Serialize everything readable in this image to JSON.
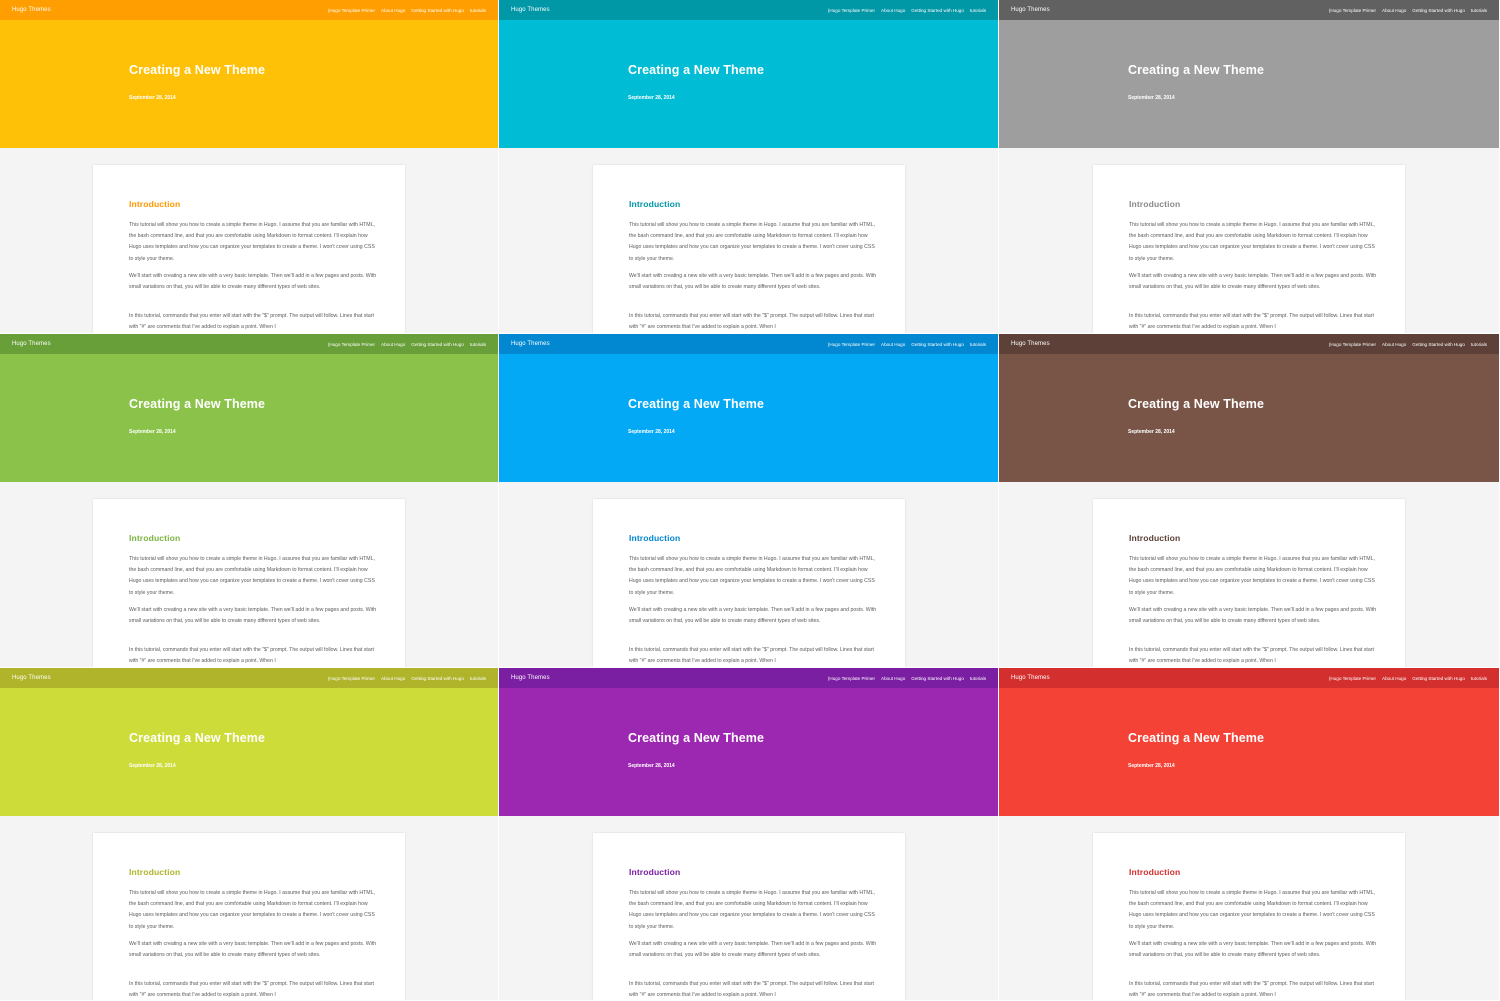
{
  "site": {
    "brand": "Hugo Themes",
    "menu": [
      "(Hugo Template Primer",
      "About Hugo",
      "Getting Started with Hugo",
      "tutorials"
    ]
  },
  "post": {
    "title": "Creating a New Theme",
    "date": "September 28, 2014",
    "heading": "Introduction",
    "paragraphs": [
      "This tutorial will show you how to create a simple theme in Hugo. I assume that you are familiar with HTML, the bash command line, and that you are comfortable using Markdown to format content. I'll explain how Hugo uses templates and how you can organize your templates to create a theme. I won't cover using CSS to style your theme.",
      "We'll start with creating a new site with a very basic template. Then we'll add in a few pages and posts. With small variations on that, you will be able to create many different types of web sites.",
      "In this tutorial, commands that you enter will start with the \"$\" prompt. The output will follow. Lines that start with \"#\" are comments that I've added to explain a point. When I"
    ]
  },
  "variants": [
    {
      "name": "amber",
      "bar": "#ff9e00",
      "hero": "#ffc107",
      "accent": "#ff9800"
    },
    {
      "name": "cyan",
      "bar": "#0097a7",
      "hero": "#00bcd4",
      "accent": "#0097a7"
    },
    {
      "name": "grey",
      "bar": "#616161",
      "hero": "#9e9e9e",
      "accent": "#8a8a8a"
    },
    {
      "name": "light-green",
      "bar": "#689f38",
      "hero": "#8bc34a",
      "accent": "#7cb342"
    },
    {
      "name": "light-blue",
      "bar": "#0288d1",
      "hero": "#03a9f4",
      "accent": "#0288d1"
    },
    {
      "name": "brown",
      "bar": "#5d4037",
      "hero": "#795548",
      "accent": "#5d4037"
    },
    {
      "name": "lime",
      "bar": "#afb42b",
      "hero": "#cddc39",
      "accent": "#afb42b"
    },
    {
      "name": "purple",
      "bar": "#7b1fa2",
      "hero": "#9c27b0",
      "accent": "#7b1fa2"
    },
    {
      "name": "red",
      "bar": "#d32f2f",
      "hero": "#f44336",
      "accent": "#d32f2f"
    }
  ]
}
